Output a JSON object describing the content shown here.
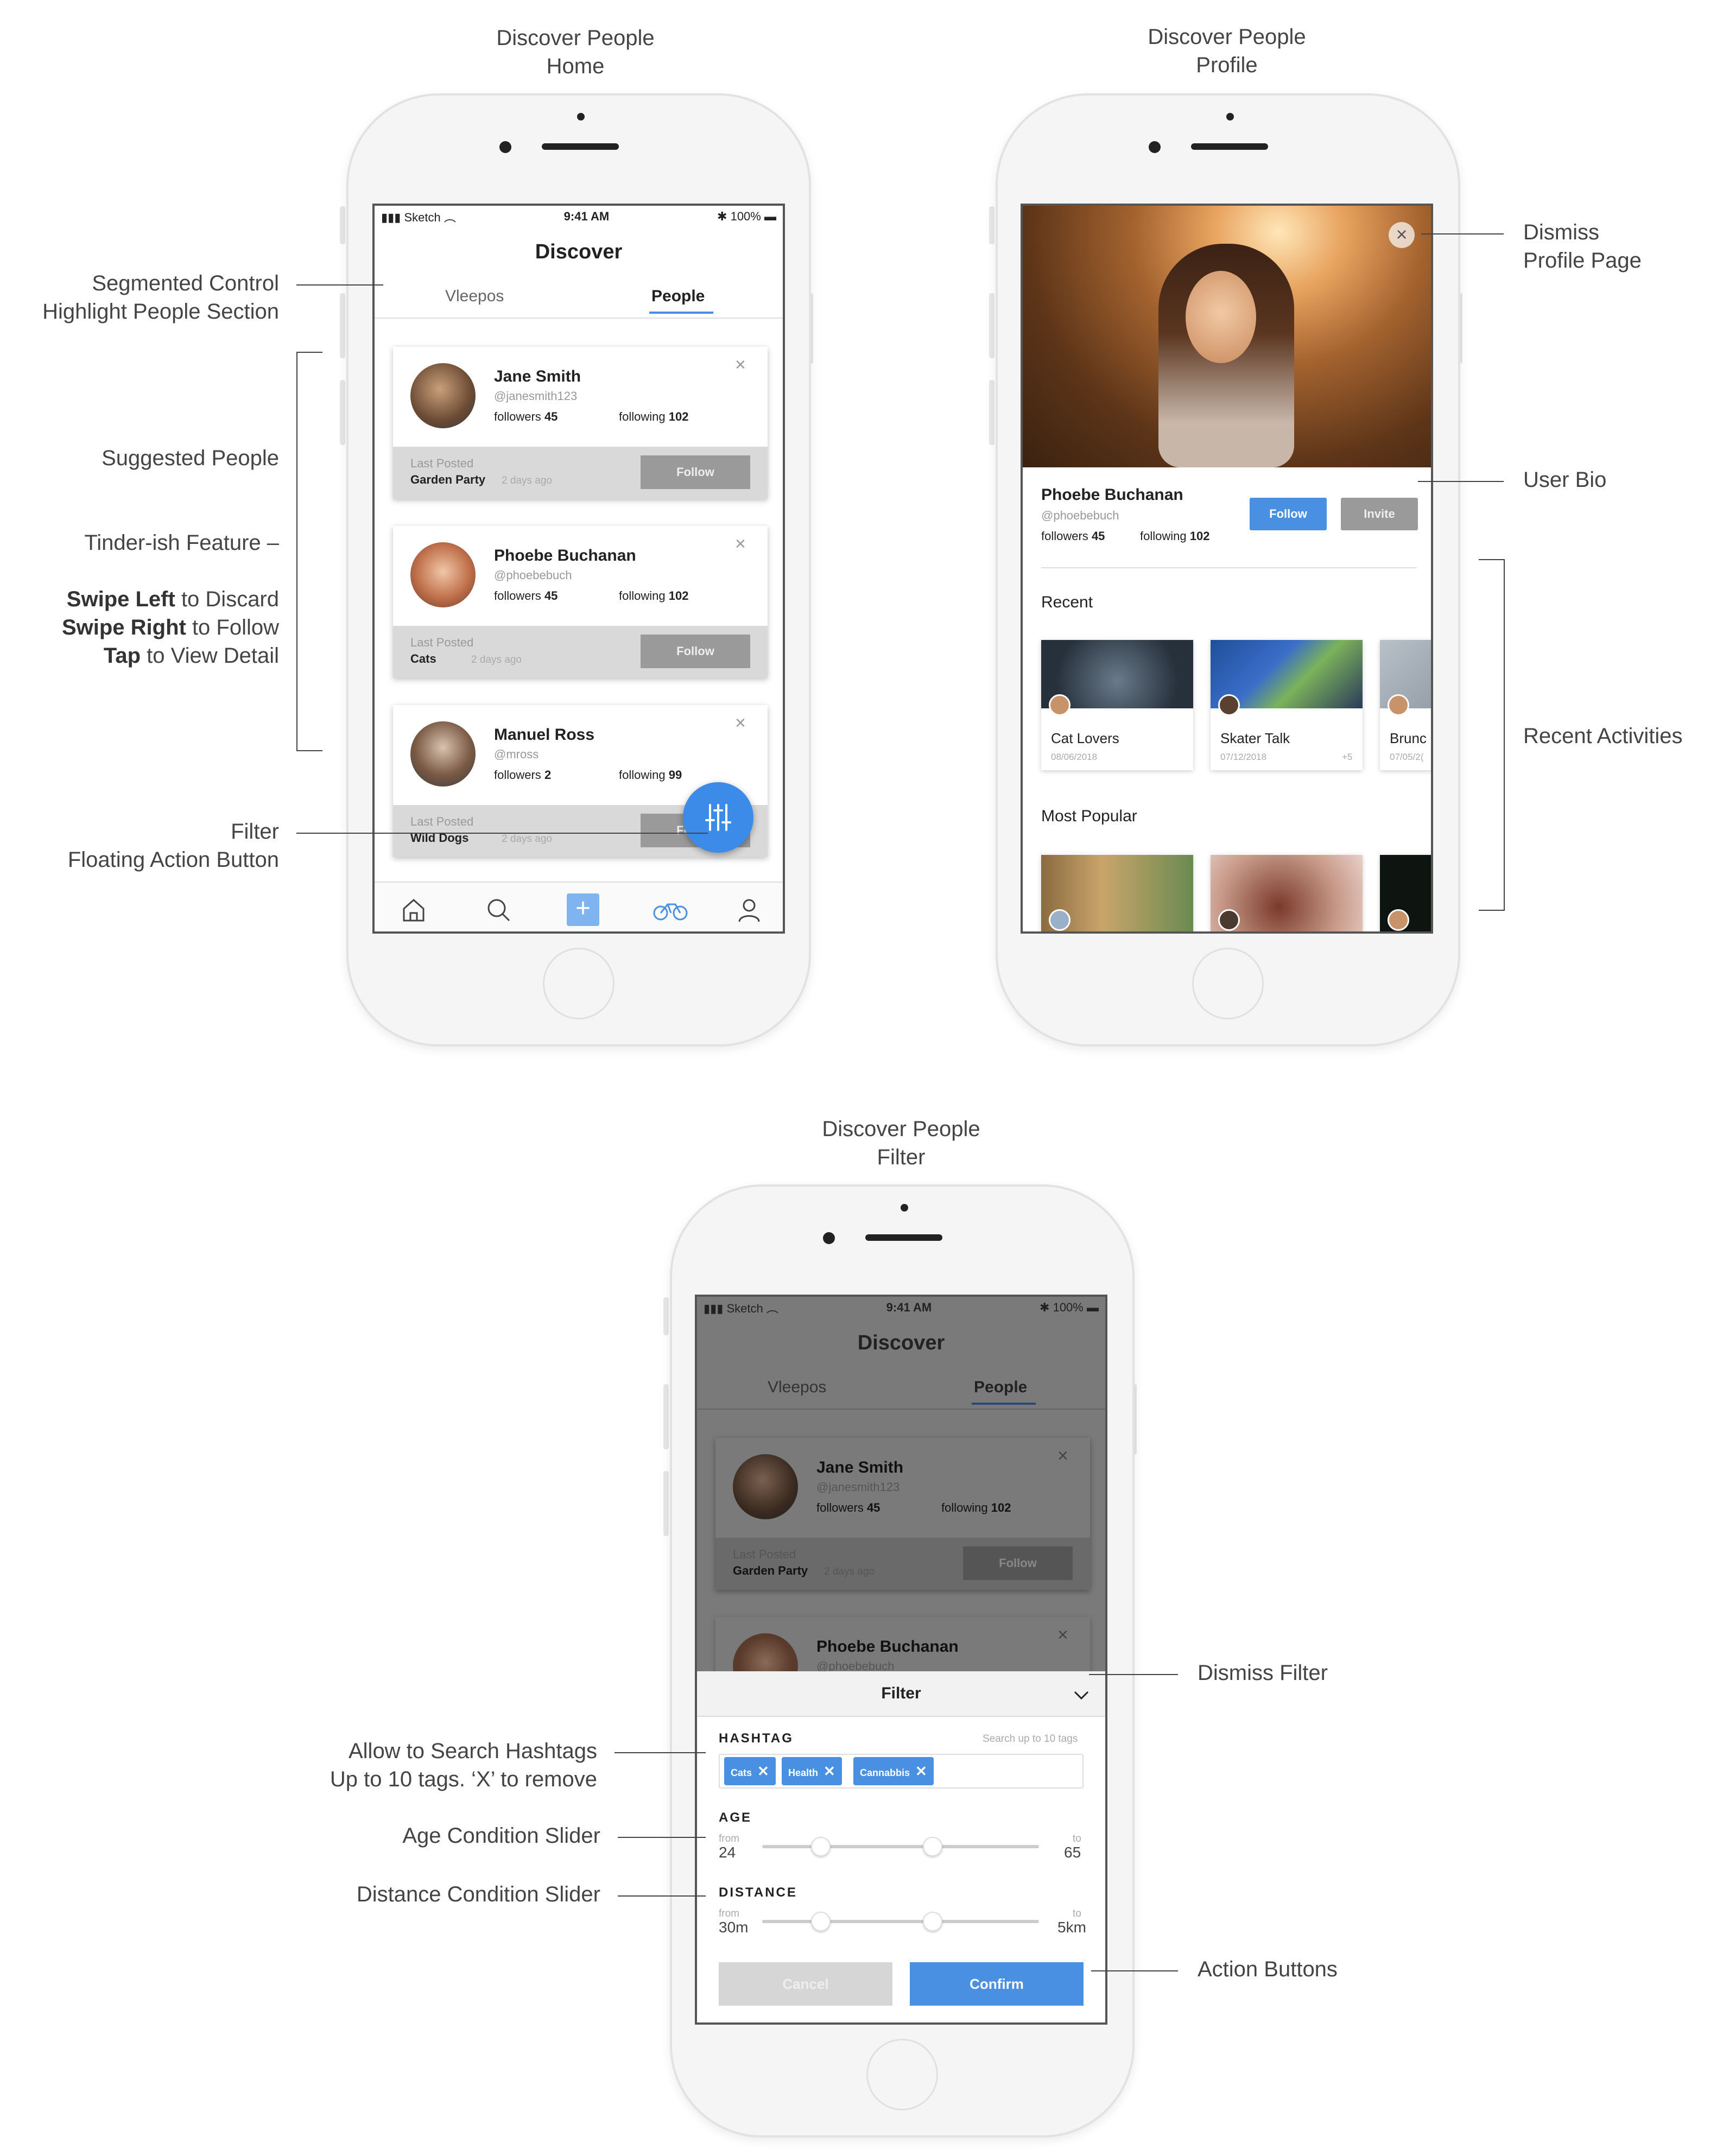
{
  "titles": {
    "home": "Discover People\nHome",
    "profile": "Discover People\nProfile",
    "filter": "Discover People\nFilter"
  },
  "annotations": {
    "segmented": "Segmented Control\nHighlight People Section",
    "suggested": "Suggested  People",
    "tinder": "Tinder-ish Feature –",
    "swipe_left_b": "Swipe Left",
    "swipe_left": " to Discard",
    "swipe_right_b": "Swipe Right",
    "swipe_right": " to Follow",
    "tap_b": "Tap",
    "tap": " to View Detail",
    "fab": "Filter\nFloating Action Button",
    "dismiss_profile": "Dismiss\nProfile Page",
    "user_bio": "User Bio",
    "recent_activities": "Recent Activities",
    "hashtags": "Allow to Search Hashtags\nUp to 10 tags. ‘X’ to remove",
    "age_slider": "Age Condition Slider",
    "distance_slider": "Distance Condition Slider",
    "dismiss_filter": "Dismiss Filter",
    "action_buttons": "Action Buttons"
  },
  "status": {
    "carrier": "Sketch",
    "time": "9:41 AM",
    "battery": "100%"
  },
  "nav": {
    "title": "Discover",
    "seg_left": "Vleepos",
    "seg_right": "People"
  },
  "cards": [
    {
      "name": "Jane Smith",
      "handle": "@janesmith123",
      "followers_label": "followers",
      "followers": "45",
      "following_label": "following",
      "following": "102",
      "last_label": "Last Posted",
      "last": "Garden Party",
      "ago": "2 days ago",
      "button": "Follow"
    },
    {
      "name": "Phoebe Buchanan",
      "handle": "@phoebebuch",
      "followers_label": "followers",
      "followers": "45",
      "following_label": "following",
      "following": "102",
      "last_label": "Last Posted",
      "last": "Cats",
      "ago": "2 days ago",
      "button": "Follow"
    },
    {
      "name": "Manuel Ross",
      "handle": "@mross",
      "followers_label": "followers",
      "followers": "2",
      "following_label": "following",
      "following": "99",
      "last_label": "Last Posted",
      "last": "Wild Dogs",
      "ago": "2 days ago",
      "button": "Follow"
    }
  ],
  "profile": {
    "name": "Phoebe Buchanan",
    "handle": "@phoebebuch",
    "followers_label": "followers",
    "followers": "45",
    "following_label": "following",
    "following": "102",
    "follow": "Follow",
    "invite": "Invite",
    "recent_label": "Recent",
    "popular_label": "Most Popular",
    "recent": [
      {
        "title": "Cat Lovers",
        "date": "08/06/2018"
      },
      {
        "title": "Skater Talk",
        "date": "07/12/2018",
        "extra": "+5"
      },
      {
        "title": "Brunc",
        "date": "07/05/2("
      }
    ]
  },
  "filter": {
    "title": "Filter",
    "hashtag_label": "HASHTAG",
    "hashtag_hint": "Search up to 10 tags",
    "tags": [
      "Cats",
      "Health",
      "Cannabbis"
    ],
    "age_label": "AGE",
    "age_from_label": "from",
    "age_from": "24",
    "age_to_label": "to",
    "age_to": "65",
    "distance_label": "DISTANCE",
    "dist_from_label": "from",
    "dist_from": "30m",
    "dist_to_label": "to",
    "dist_to": "5km",
    "cancel": "Cancel",
    "confirm": "Confirm"
  },
  "colors": {
    "accent": "#4a90e2",
    "fab": "#3d8be8",
    "gray_button": "#9a9a9a"
  }
}
